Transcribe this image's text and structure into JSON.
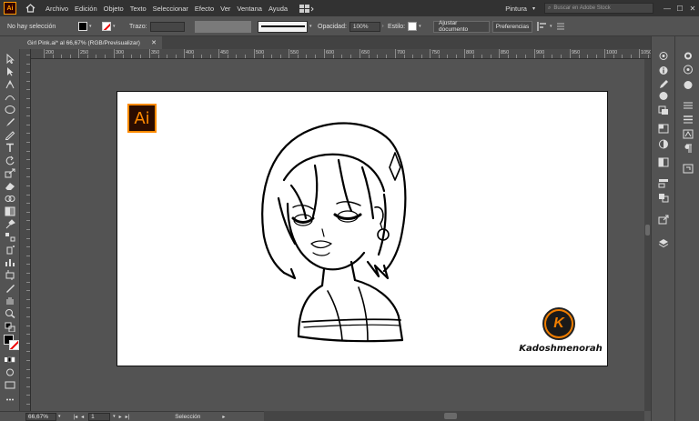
{
  "menubar": {
    "app_logo": "Ai",
    "menus": [
      "Archivo",
      "Edición",
      "Objeto",
      "Texto",
      "Seleccionar",
      "Efecto",
      "Ver",
      "Ventana",
      "Ayuda"
    ],
    "workspace": "Pintura",
    "stock_search_placeholder": "Buscar en Adobe Stock",
    "window_buttons": [
      "—",
      "☐",
      "✕"
    ]
  },
  "controlbar": {
    "selection_status": "No hay selección",
    "stroke_label": "Trazo:",
    "opacity_label": "Opacidad:",
    "opacity_value": "100%",
    "style_label": "Estilo:",
    "adjust_document_button": "Ajustar documento",
    "preferences_button": "Preferencias"
  },
  "tab": {
    "title": "Girl Pink.ai* al 66,67% (RGB/Previsualizar)",
    "close": "✕"
  },
  "rulers": {
    "horizontal_labels": [
      "200",
      "150",
      "100",
      "50",
      "0",
      "50",
      "100",
      "150",
      "200",
      "250",
      "300",
      "350",
      "400",
      "450",
      "500",
      "550",
      "600",
      "650",
      "700",
      "750",
      "800",
      "850",
      "900",
      "950",
      "1000",
      "1050",
      "1100",
      "1150",
      "1200",
      "1250",
      "1300",
      "1350",
      "1400",
      "1450"
    ]
  },
  "artboard": {
    "ai_badge": "Ai",
    "k_logo_letter": "K",
    "signature_text": "Kadoshmenorah"
  },
  "statusbar": {
    "zoom": "66,67%",
    "artboard_number": "1",
    "tool_status": "Selección"
  },
  "colors": {
    "menubar_bg": "#323232",
    "ui_bg": "#535353",
    "ai_orange": "#ff8a00",
    "logo_orange": "#ef7d00",
    "artboard_bg": "#ffffff"
  }
}
